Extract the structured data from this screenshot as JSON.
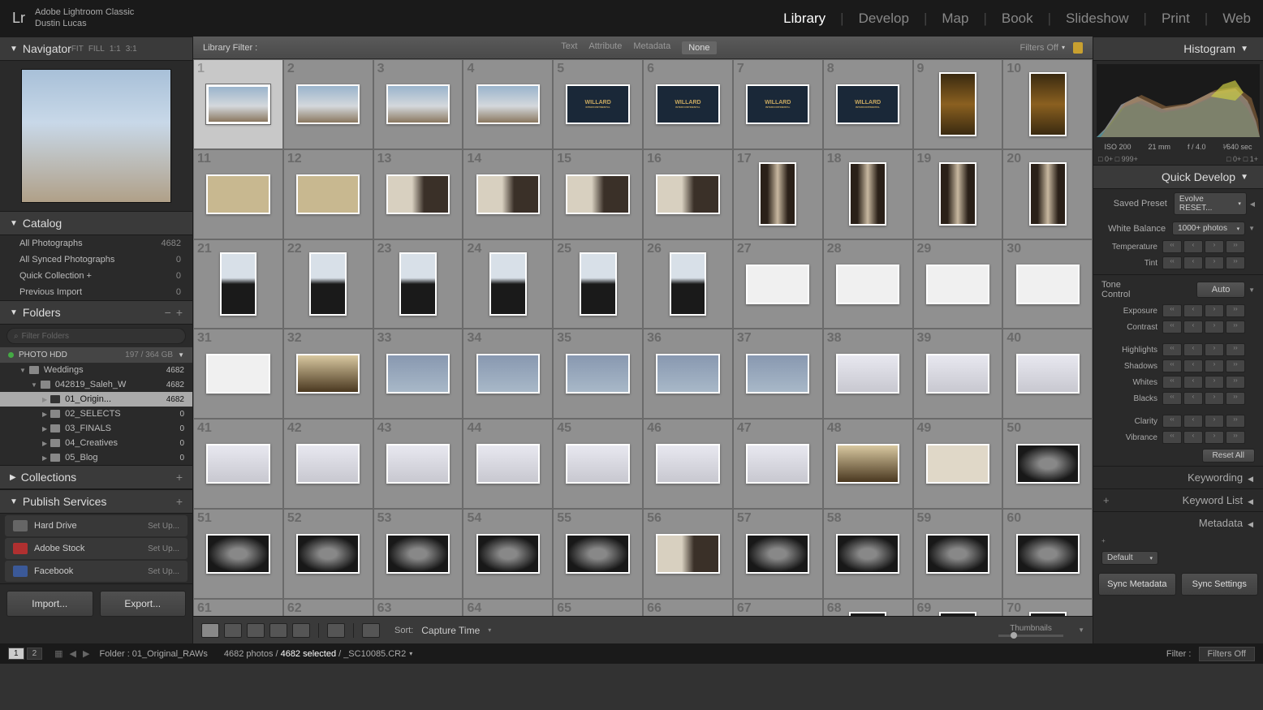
{
  "app": {
    "name": "Adobe Lightroom Classic",
    "user": "Dustin Lucas",
    "logo": "Lr"
  },
  "modules": [
    "Library",
    "Develop",
    "Map",
    "Book",
    "Slideshow",
    "Print",
    "Web"
  ],
  "active_module": "Library",
  "navigator": {
    "title": "Navigator",
    "sizes": [
      "FIT",
      "FILL",
      "1:1",
      "3:1"
    ]
  },
  "catalog": {
    "title": "Catalog",
    "items": [
      {
        "label": "All Photographs",
        "count": "4682"
      },
      {
        "label": "All Synced Photographs",
        "count": "0"
      },
      {
        "label": "Quick Collection  +",
        "count": "0"
      },
      {
        "label": "Previous Import",
        "count": "0"
      }
    ]
  },
  "folders": {
    "title": "Folders",
    "search_placeholder": "Filter Folders",
    "drive": {
      "name": "PHOTO HDD",
      "usage": "197 / 364 GB"
    },
    "tree": [
      {
        "label": "Weddings",
        "count": "4682",
        "indent": 1,
        "expanded": true
      },
      {
        "label": "042819_Saleh_W",
        "count": "4682",
        "indent": 2,
        "expanded": true
      },
      {
        "label": "01_Origin...",
        "count": "4682",
        "indent": 3,
        "active": true
      },
      {
        "label": "02_SELECTS",
        "count": "0",
        "indent": 3
      },
      {
        "label": "03_FINALS",
        "count": "0",
        "indent": 3
      },
      {
        "label": "04_Creatives",
        "count": "0",
        "indent": 3
      },
      {
        "label": "05_Blog",
        "count": "0",
        "indent": 3
      }
    ]
  },
  "collections": {
    "title": "Collections"
  },
  "publish": {
    "title": "Publish Services",
    "items": [
      {
        "label": "Hard Drive",
        "setup": "Set Up...",
        "color": "#666"
      },
      {
        "label": "Adobe Stock",
        "setup": "Set Up...",
        "color": "#b03030"
      },
      {
        "label": "Facebook",
        "setup": "Set Up...",
        "color": "#3b5998"
      }
    ]
  },
  "left_buttons": {
    "import": "Import...",
    "export": "Export..."
  },
  "filter_bar": {
    "label": "Library Filter :",
    "tabs": [
      "Text",
      "Attribute",
      "Metadata",
      "None"
    ],
    "selected": "None",
    "filters_off": "Filters Off"
  },
  "toolbar": {
    "sort_label": "Sort:",
    "sort_value": "Capture Time",
    "thumbnails_label": "Thumbnails"
  },
  "histogram": {
    "title": "Histogram",
    "info": [
      "ISO 200",
      "21 mm",
      "f / 4.0",
      "¹⁄640 sec"
    ],
    "ticks": {
      "left": [
        "0+",
        "0+"
      ],
      "right": [
        "999+",
        "1+"
      ]
    }
  },
  "quick_develop": {
    "title": "Quick Develop",
    "saved_preset": {
      "label": "Saved Preset",
      "value": "Evolve RESET..."
    },
    "white_balance": {
      "label": "White Balance",
      "value": "1000+ photos"
    },
    "temp_tint": [
      "Temperature",
      "Tint"
    ],
    "tone": {
      "title": "Tone Control",
      "auto": "Auto"
    },
    "adjustments": [
      "Exposure",
      "Contrast",
      "Highlights",
      "Shadows",
      "Whites",
      "Blacks",
      "Clarity",
      "Vibrance"
    ],
    "reset": "Reset All"
  },
  "right_panels": [
    "Keywording",
    "Keyword List",
    "Metadata"
  ],
  "metadata_preset": "Default",
  "sync_buttons": [
    "Sync Metadata",
    "Sync Settings"
  ],
  "status": {
    "pages": [
      "1",
      "2"
    ],
    "folder_label": "Folder :",
    "folder_name": "01_Original_RAWs",
    "photo_count": "4682 photos /",
    "selected": "4682 selected",
    "filename": "/ _SC10085.CR2",
    "filter_label": "Filter :",
    "filter_value": "Filters Off"
  },
  "grid": {
    "cells": [
      {
        "n": 1,
        "cls": "t-building",
        "sel": true
      },
      {
        "n": 2,
        "cls": "t-building"
      },
      {
        "n": 3,
        "cls": "t-building"
      },
      {
        "n": 4,
        "cls": "t-building"
      },
      {
        "n": 5,
        "cls": "t-willard"
      },
      {
        "n": 6,
        "cls": "t-willard"
      },
      {
        "n": 7,
        "cls": "t-willard"
      },
      {
        "n": 8,
        "cls": "t-willard"
      },
      {
        "n": 9,
        "cls": "t-gold",
        "p": true
      },
      {
        "n": 10,
        "cls": "t-gold",
        "p": true
      },
      {
        "n": 11,
        "cls": "t-tan"
      },
      {
        "n": 12,
        "cls": "t-tan"
      },
      {
        "n": 13,
        "cls": "t-prep"
      },
      {
        "n": 14,
        "cls": "t-prep"
      },
      {
        "n": 15,
        "cls": "t-prep"
      },
      {
        "n": 16,
        "cls": "t-prep"
      },
      {
        "n": 17,
        "cls": "t-prep2",
        "p": true
      },
      {
        "n": 18,
        "cls": "t-prep2",
        "p": true
      },
      {
        "n": 19,
        "cls": "t-prep2",
        "p": true
      },
      {
        "n": 20,
        "cls": "t-prep2",
        "p": true
      },
      {
        "n": 21,
        "cls": "t-silh",
        "p": true
      },
      {
        "n": 22,
        "cls": "t-silh",
        "p": true
      },
      {
        "n": 23,
        "cls": "t-silh",
        "p": true
      },
      {
        "n": 24,
        "cls": "t-silh",
        "p": true
      },
      {
        "n": 25,
        "cls": "t-silh",
        "p": true
      },
      {
        "n": 26,
        "cls": "t-silh",
        "p": true
      },
      {
        "n": 27,
        "cls": "t-white"
      },
      {
        "n": 28,
        "cls": "t-white"
      },
      {
        "n": 29,
        "cls": "t-white"
      },
      {
        "n": 30,
        "cls": "t-white"
      },
      {
        "n": 31,
        "cls": "t-white"
      },
      {
        "n": 32,
        "cls": "t-chandelier"
      },
      {
        "n": 33,
        "cls": "t-blue"
      },
      {
        "n": 34,
        "cls": "t-blue"
      },
      {
        "n": 35,
        "cls": "t-blue"
      },
      {
        "n": 36,
        "cls": "t-blue"
      },
      {
        "n": 37,
        "cls": "t-blue"
      },
      {
        "n": 38,
        "cls": "t-rings"
      },
      {
        "n": 39,
        "cls": "t-rings"
      },
      {
        "n": 40,
        "cls": "t-rings"
      },
      {
        "n": 41,
        "cls": "t-rings"
      },
      {
        "n": 42,
        "cls": "t-rings"
      },
      {
        "n": 43,
        "cls": "t-rings"
      },
      {
        "n": 44,
        "cls": "t-rings"
      },
      {
        "n": 45,
        "cls": "t-rings"
      },
      {
        "n": 46,
        "cls": "t-rings"
      },
      {
        "n": 47,
        "cls": "t-rings"
      },
      {
        "n": 48,
        "cls": "t-chandelier"
      },
      {
        "n": 49,
        "cls": "t-paper"
      },
      {
        "n": 50,
        "cls": "t-ringsdark"
      },
      {
        "n": 51,
        "cls": "t-ringsdark"
      },
      {
        "n": 52,
        "cls": "t-ringsdark"
      },
      {
        "n": 53,
        "cls": "t-ringsdark"
      },
      {
        "n": 54,
        "cls": "t-ringsdark"
      },
      {
        "n": 55,
        "cls": "t-ringsdark"
      },
      {
        "n": 56,
        "cls": "t-prep"
      },
      {
        "n": 57,
        "cls": "t-ringsdark"
      },
      {
        "n": 58,
        "cls": "t-ringsdark"
      },
      {
        "n": 59,
        "cls": "t-ringsdark"
      },
      {
        "n": 60,
        "cls": "t-ringsdark"
      },
      {
        "n": 61,
        "cls": "t-paper"
      },
      {
        "n": 62,
        "cls": "t-paper"
      },
      {
        "n": 63,
        "cls": "t-ringsdark"
      },
      {
        "n": 64,
        "cls": "t-ringsdark"
      },
      {
        "n": 65,
        "cls": "t-ringsdark"
      },
      {
        "n": 66,
        "cls": "t-ringsdark"
      },
      {
        "n": 67,
        "cls": "t-ringsdark"
      },
      {
        "n": 68,
        "cls": "t-dark",
        "p": true
      },
      {
        "n": 69,
        "cls": "t-dark",
        "p": true
      },
      {
        "n": 70,
        "cls": "t-dark",
        "p": true
      }
    ]
  }
}
